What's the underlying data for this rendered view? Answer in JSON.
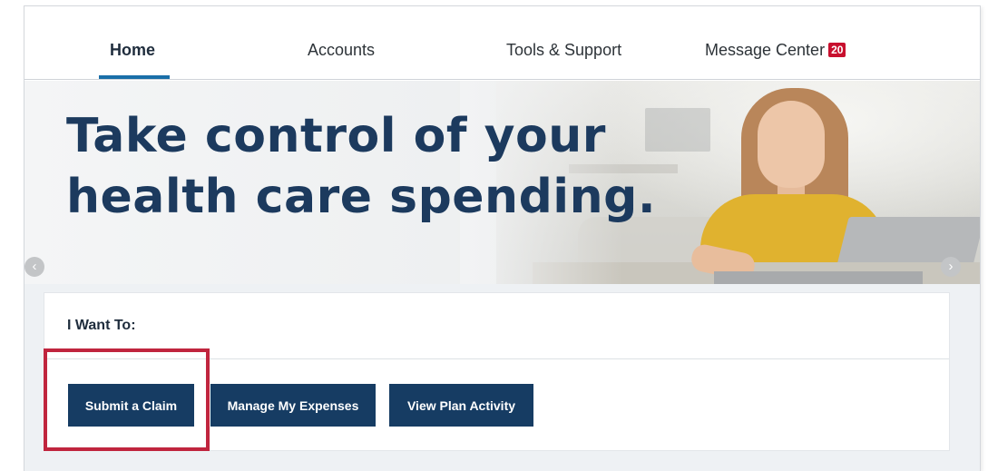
{
  "nav": {
    "home": "Home",
    "accounts": "Accounts",
    "tools": "Tools & Support",
    "message_center": "Message Center",
    "message_count": "20"
  },
  "hero": {
    "line1": "Take control of your",
    "line2": "health care spending.",
    "prev_icon": "chevron-left-icon",
    "next_icon": "chevron-right-icon"
  },
  "panel": {
    "title": "I Want To:",
    "buttons": {
      "submit_claim": "Submit a Claim",
      "manage_expenses": "Manage My Expenses",
      "view_plan": "View Plan Activity"
    }
  },
  "colors": {
    "brand_navy": "#163c63",
    "heading_navy": "#1c3a5e",
    "active_tab": "#1a6fa8",
    "badge_red": "#c8102e",
    "highlight_red": "#c0253e"
  }
}
